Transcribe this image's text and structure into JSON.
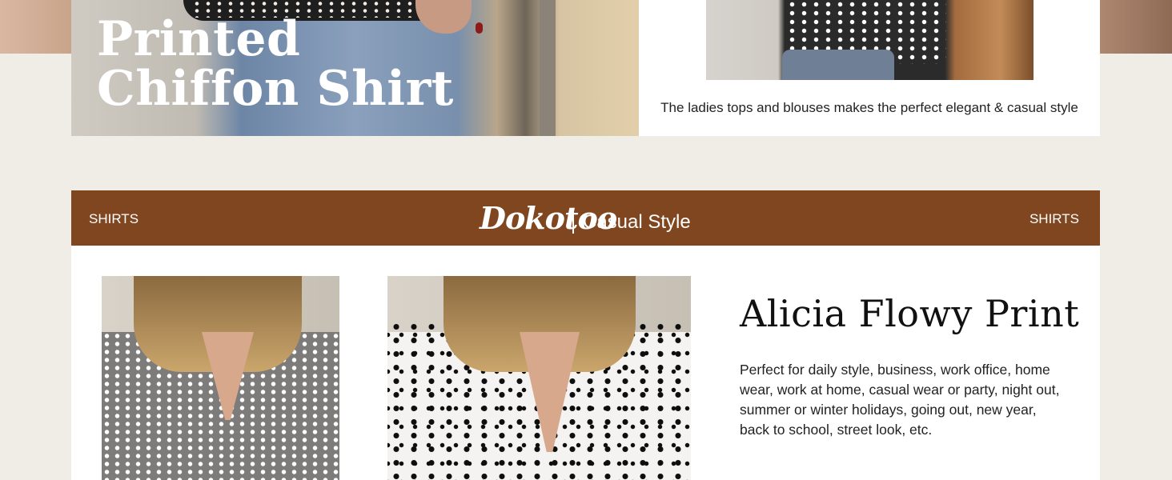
{
  "hero": {
    "title_line1": "Printed",
    "title_line2": "Chiffon Shirt"
  },
  "promo": {
    "caption": "The ladies tops and blouses makes the perfect elegant & casual style"
  },
  "banner": {
    "left_label": "SHIRTS",
    "brand": "Dokotoo",
    "tagline": "Casual Style",
    "right_label": "SHIRTS",
    "color": "#7f4620"
  },
  "product": {
    "title": "Alicia Flowy Print",
    "description": "Perfect for daily style, business, work office, home wear, work at home, casual wear or party, night out, summer or winter holidays, going out, new year, back to school, street look, etc."
  },
  "colors": {
    "page_background": "#f0ece6",
    "card_background": "#ffffff"
  }
}
